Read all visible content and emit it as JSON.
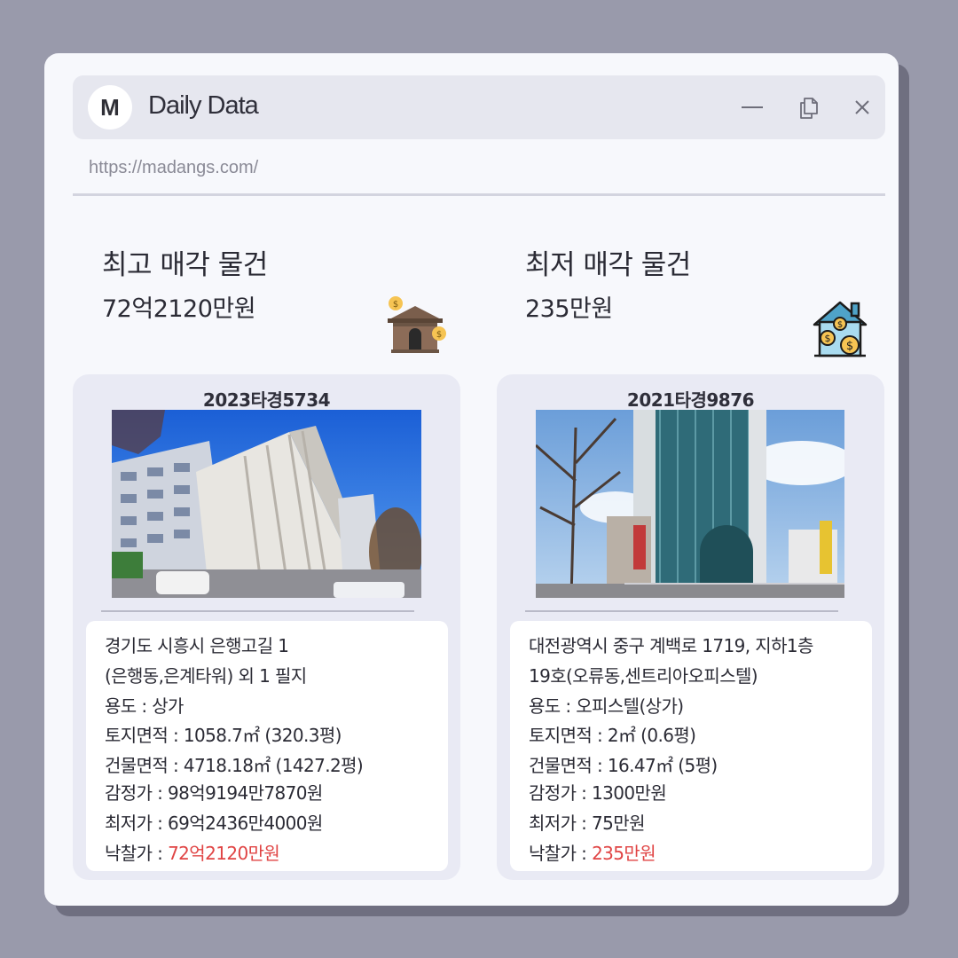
{
  "app": {
    "title": "Daily Data",
    "logo_letter": "M",
    "url": "https://madangs.com/"
  },
  "window_controls": [
    "minimize-icon",
    "restore-icon",
    "close-icon"
  ],
  "highest": {
    "label": "최고 매각 물건",
    "value": "72억2120만원",
    "icon": "house-money-icon",
    "case_no": "2023타경5734",
    "address_line1": "경기도 시흥시 은행고길 1",
    "address_line2": "(은행동,은계타워) 외 1 필지",
    "usage": "용도 : 상가",
    "land_area": "토지면적 : 1058.7㎡ (320.3평)",
    "building_area": "건물면적 : 4718.18㎡ (1427.2평)",
    "appraisal": "감정가 : 98억9194만7870원",
    "minimum": "최저가 : 69억2436만4000원",
    "winning_label": "낙찰가 : ",
    "winning_value": "72억2120만원"
  },
  "lowest": {
    "label": "최저 매각 물건",
    "value": "235만원",
    "icon": "house-coins-icon",
    "case_no": "2021타경9876",
    "address_line1": "대전광역시 중구 계백로 1719, 지하1층",
    "address_line2": "19호(오류동,센트리아오피스텔)",
    "usage": "용도 : 오피스텔(상가)",
    "land_area": "토지면적 : 2㎡ (0.6평)",
    "building_area": "건물면적 : 16.47㎡ (5평)",
    "appraisal": "감정가 : 1300만원",
    "minimum": "최저가 : 75만원",
    "winning_label": "낙찰가 : ",
    "winning_value": "235만원"
  },
  "colors": {
    "background": "#999aab",
    "window": "#f7f8fc",
    "titlebar": "#e6e7ef",
    "card": "#e9eaf4",
    "price_accent": "#e04444"
  }
}
